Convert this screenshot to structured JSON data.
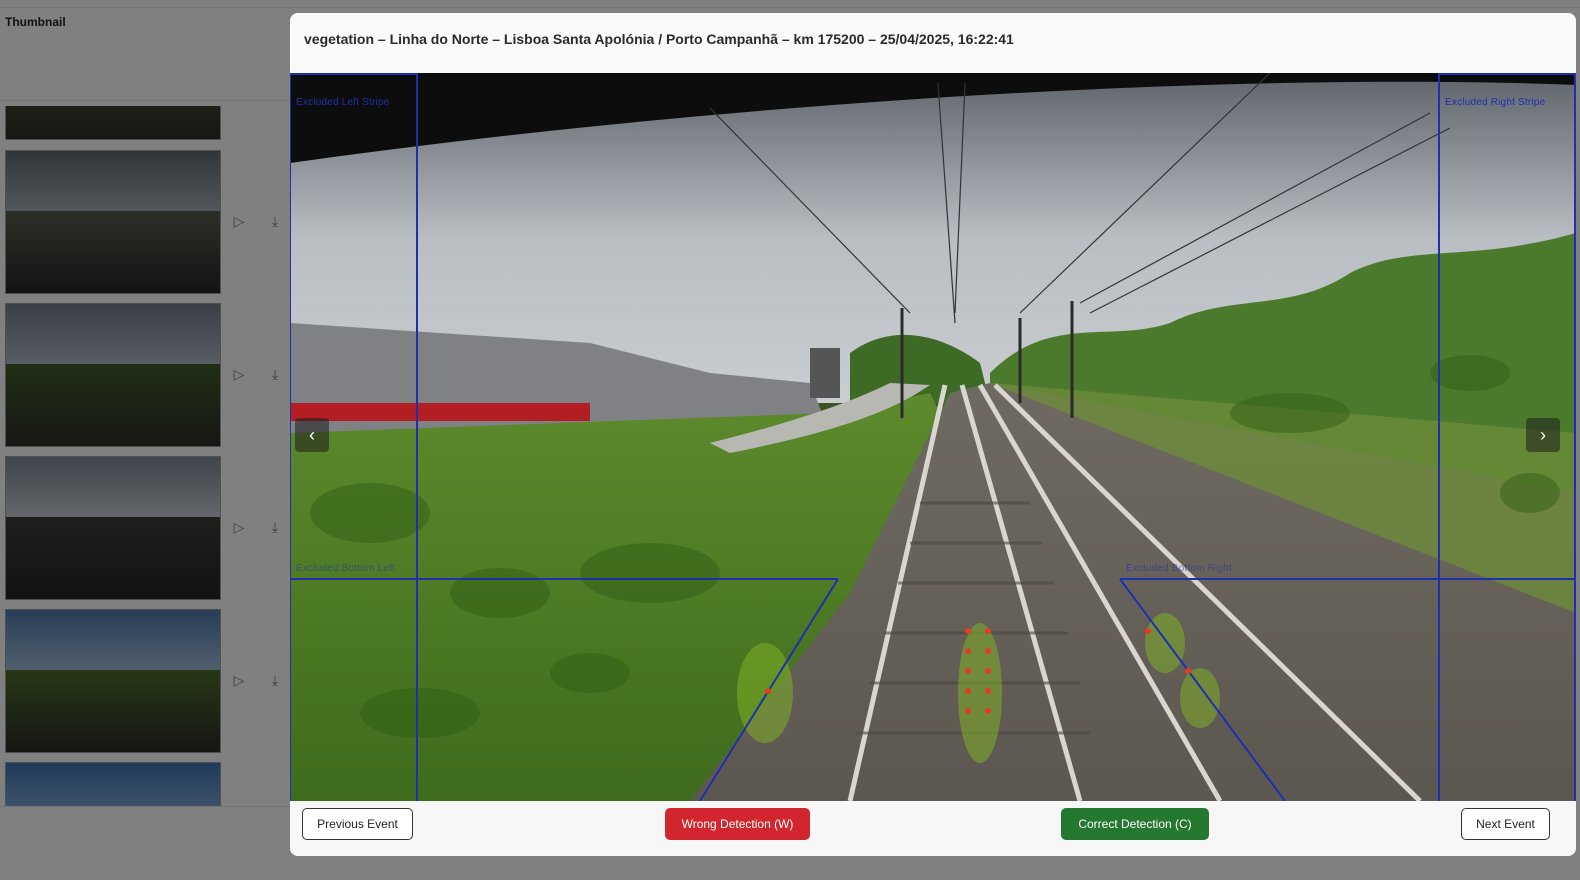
{
  "list": {
    "column_header": "Thumbnail",
    "rows": [
      {
        "thumb": "railway-frame",
        "play_icon": "▷",
        "download_icon": "⤓"
      },
      {
        "thumb": "railway-frame",
        "play_icon": "▷",
        "download_icon": "⤓"
      },
      {
        "thumb": "railway-frame",
        "play_icon": "▷",
        "download_icon": "⤓"
      },
      {
        "thumb": "railway-frame",
        "play_icon": "▷",
        "download_icon": "⤓"
      }
    ]
  },
  "modal": {
    "title": "vegetation – Linha do Norte – Lisboa Santa Apolónia / Porto Campanhã – km 175200 – 25/04/2025, 16:22:41",
    "viewer": {
      "prev_arrow": "‹",
      "next_arrow": "›",
      "zone_labels": {
        "left_stripe": "Excluded Left Stripe",
        "right_stripe": "Excluded Right Stripe",
        "bottom_left": "Excluded Bottom Left",
        "bottom_right": "Excluded Bottom Right"
      }
    },
    "footer": {
      "previous": "Previous Event",
      "wrong": "Wrong Detection (W)",
      "correct": "Correct Detection (C)",
      "next": "Next Event"
    }
  },
  "colors": {
    "wrong_button": "#d2262e",
    "correct_button": "#24782f",
    "zone_lines": "#1f2fb0",
    "detection_points": "#e53b25"
  },
  "icons": {
    "play": "play-icon",
    "download": "download-icon",
    "prev": "chevron-left-icon",
    "next": "chevron-right-icon"
  }
}
